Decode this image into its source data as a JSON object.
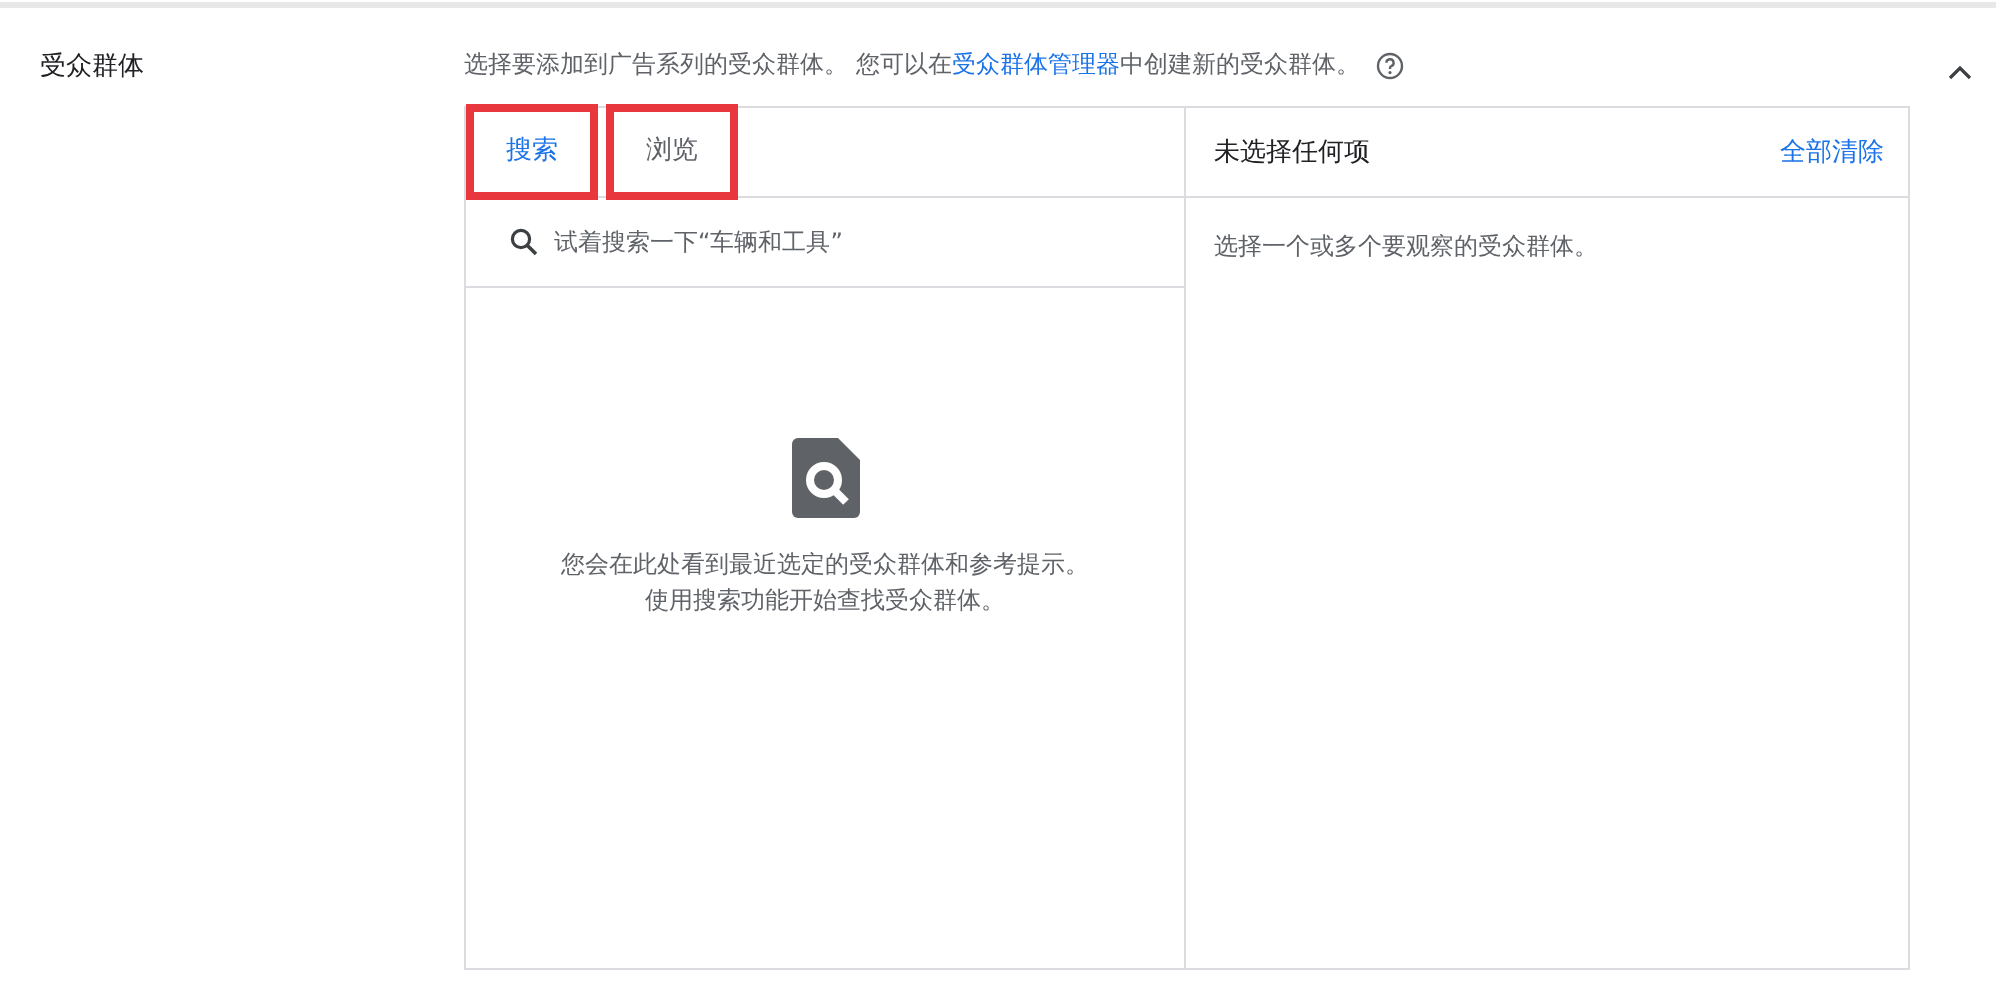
{
  "section": {
    "label": "受众群体",
    "description": "选择要添加到广告系列的受众群体。 您可以在**受众群体管理器**中创建新的受众群体。",
    "expanded": true
  },
  "tabs": [
    {
      "label": "搜索",
      "selected": true,
      "highlighted": true
    },
    {
      "label": "浏览",
      "selected": false,
      "highlighted": true
    }
  ],
  "search": {
    "placeholder": "试着搜索一下“车辆和工具”"
  },
  "empty_state": {
    "lines": [
      "您会在此处看到最近选定的受众群体和参考提示。",
      "使用搜索功能开始查找受众群体。"
    ]
  },
  "selection": {
    "title": "未选择任何项",
    "clear_link": "全部清除",
    "hint": "选择一个或多个要观察的受众群体。"
  }
}
